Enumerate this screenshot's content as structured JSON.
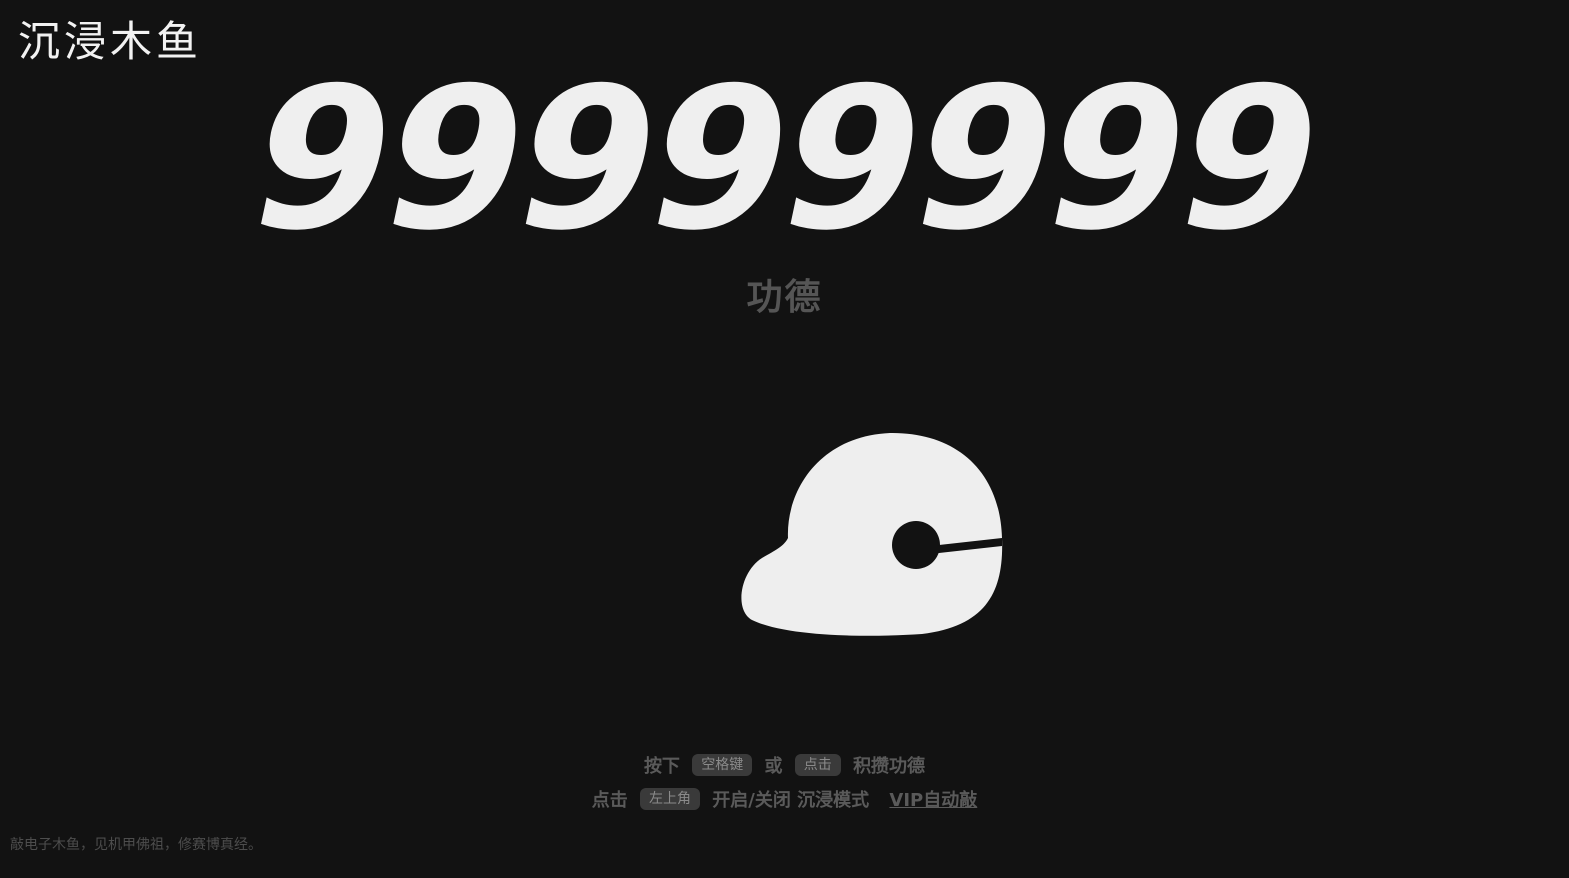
{
  "header": {
    "title": "沉浸木鱼"
  },
  "counter": {
    "value": "99999999",
    "label": "功德"
  },
  "fish": {
    "icon": "wooden-fish-icon",
    "color": "#eeeeee"
  },
  "instructions": {
    "line1": {
      "prefix": "按下",
      "key1": "空格键",
      "or": "或",
      "key2": "点击",
      "suffix": "积攒功德"
    },
    "line2": {
      "prefix": "点击",
      "key": "左上角",
      "action": "开启/关闭 沉浸模式",
      "vip_link": "VIP自动敲"
    }
  },
  "footer": {
    "tagline": "敲电子木鱼，见机甲佛祖，修赛博真经。"
  },
  "colors": {
    "background": "#121212",
    "foreground": "#efefef",
    "muted": "#555555",
    "key_bg": "#3a3a3a"
  }
}
